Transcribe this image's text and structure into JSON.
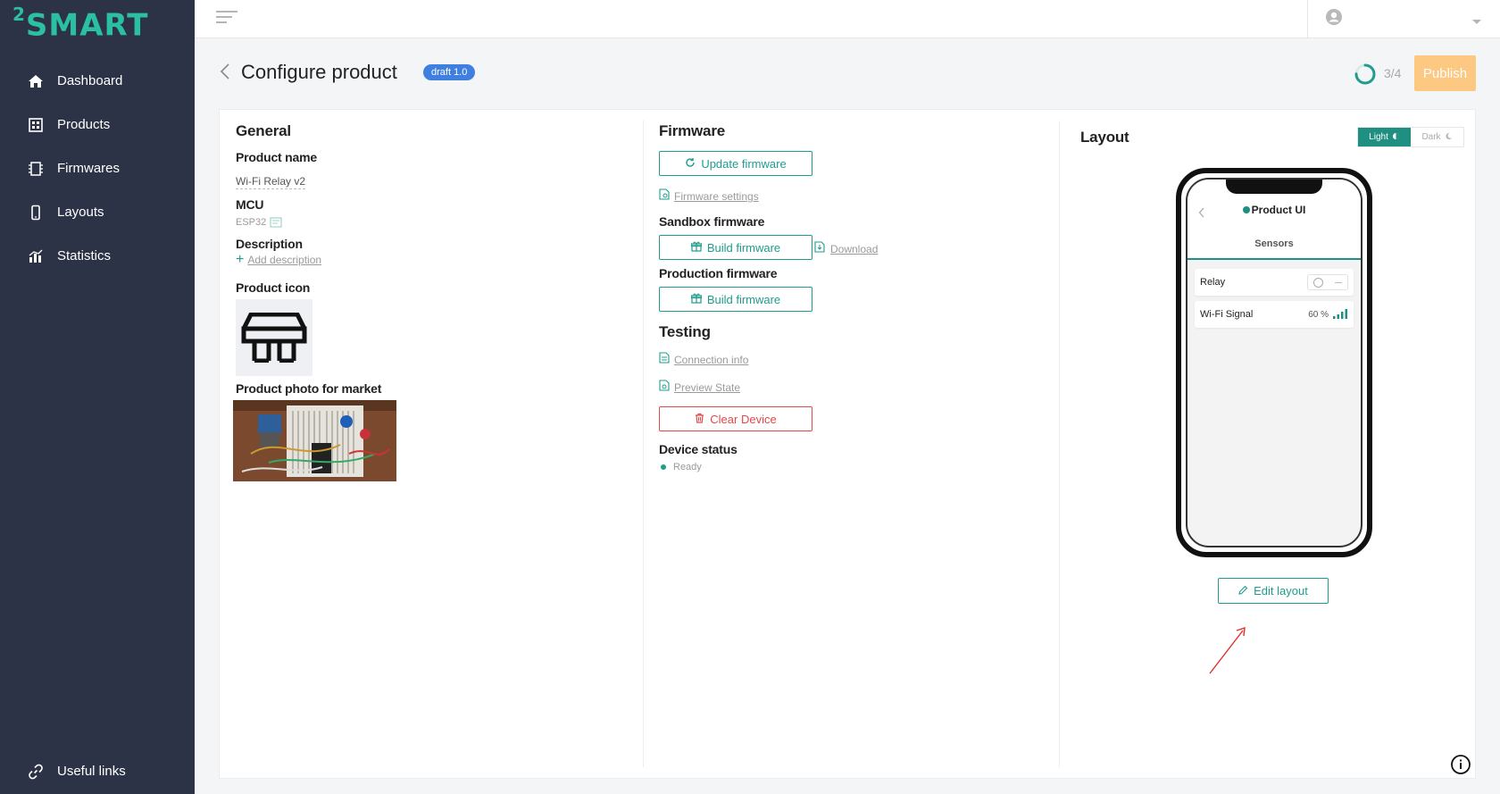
{
  "brand": {
    "logo_sup": "2",
    "logo_text": "SMART",
    "accent": "#2bbfa4",
    "teal": "#1f9c8d",
    "sidebar_bg": "#2d3347"
  },
  "sidebar": {
    "items": [
      {
        "label": "Dashboard",
        "icon": "home-icon"
      },
      {
        "label": "Products",
        "icon": "products-icon"
      },
      {
        "label": "Firmwares",
        "icon": "firmware-icon"
      },
      {
        "label": "Layouts",
        "icon": "phone-icon"
      },
      {
        "label": "Statistics",
        "icon": "chart-icon"
      }
    ],
    "bottom_link": "Useful links"
  },
  "header": {
    "title": "Configure product",
    "badge": "draft 1.0",
    "progress_text": "3/4",
    "progress_fraction": 0.75,
    "publish_label": "Publish"
  },
  "general": {
    "heading": "General",
    "product_name_label": "Product name",
    "product_name_value": "Wi-Fi Relay v2",
    "mcu_label": "MCU",
    "mcu_value": "ESP32",
    "description_label": "Description",
    "add_description": "Add description",
    "product_icon_label": "Product icon",
    "photo_label": "Product photo for market"
  },
  "firmware": {
    "heading": "Firmware",
    "update_button": "Update firmware",
    "settings_link": "Firmware settings",
    "sandbox_label": "Sandbox firmware",
    "build_button": "Build firmware",
    "download_link": "Download",
    "production_label": "Production firmware",
    "build_button_prod": "Build firmware",
    "testing_heading": "Testing",
    "connection_info": "Connection info",
    "preview_state": "Preview State",
    "clear_device": "Clear Device",
    "device_status_label": "Device status",
    "device_status_value": "Ready"
  },
  "layout": {
    "heading": "Layout",
    "theme_light": "Light",
    "theme_dark": "Dark",
    "phone_title": "Product UI",
    "phone_tab": "Sensors",
    "rows": [
      {
        "label": "Relay",
        "value": ""
      },
      {
        "label": "Wi-Fi Signal",
        "value": "60 %"
      }
    ],
    "edit_button": "Edit layout"
  }
}
